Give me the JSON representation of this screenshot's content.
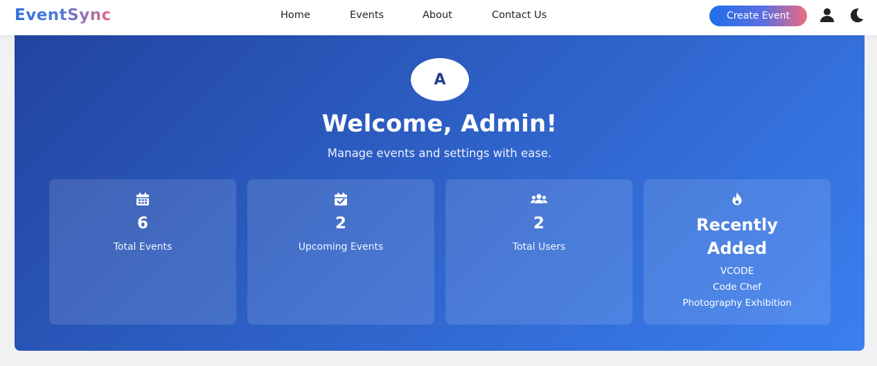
{
  "navbar": {
    "brand": "EventSync",
    "links": [
      "Home",
      "Events",
      "About",
      "Contact Us"
    ],
    "create_label": "Create Event"
  },
  "hero": {
    "avatar_initial": "A",
    "welcome": "Welcome, Admin!",
    "subtitle": "Manage events and settings with ease."
  },
  "stats": [
    {
      "value": "6",
      "label": "Total Events",
      "icon": "calendar-icon"
    },
    {
      "value": "2",
      "label": "Upcoming Events",
      "icon": "calendar-check-icon"
    },
    {
      "value": "2",
      "label": "Total Users",
      "icon": "users-icon"
    }
  ],
  "recent": {
    "icon": "fire-icon",
    "title_line1": "Recently",
    "title_line2": "Added",
    "items": [
      "VCODE",
      "Code Chef",
      "Photography Exhibition"
    ]
  },
  "colors": {
    "primary": "#1f6fea",
    "accent": "#ee6b7f",
    "hero_start": "#2244a0",
    "hero_end": "#3a7ff0"
  }
}
